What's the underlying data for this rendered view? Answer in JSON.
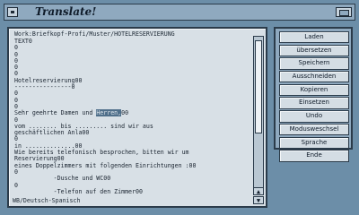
{
  "window": {
    "title": "Translate!"
  },
  "editor": {
    "path": "Work:Briefkopf-Profi/Muster/HOTELRESERVIERUNG",
    "status": "WB/Deutsch-Spanisch",
    "lines": [
      "TEXT0",
      "0",
      "0",
      "0",
      "0",
      "0",
      "Hotelreservierung00",
      "----------------0",
      "0",
      "0",
      "0",
      "Sehr geehrte Damen und",
      "0",
      "vom ........ bis ......... sind wir aus",
      "geschäftlichen Anla00",
      "0",
      "in ..............00",
      "Wie bereits telefonisch besprochen, bitten wir um",
      "Reservierung00",
      "eines Doppelzimmers mit folgenden Einrichtungen :00",
      "0",
      "           -Dusche und WC00",
      "0",
      "           -Telefon auf den Zimmer00"
    ],
    "highlight_line": {
      "prefix": "Sehr geehrte Damen und ",
      "selected": "Herren,",
      "suffix": "00"
    }
  },
  "menu": {
    "buttons": [
      "Laden",
      "übersetzen",
      "Speichern",
      "Ausschneiden",
      "Kopieren",
      "Einsetzen",
      "Undo",
      "Modusweschsel",
      "Sprache",
      "Ende"
    ]
  },
  "colors": {
    "background": "#6c8ea8",
    "panel": "#8fa9bf",
    "editor": "#d8e0e6"
  }
}
